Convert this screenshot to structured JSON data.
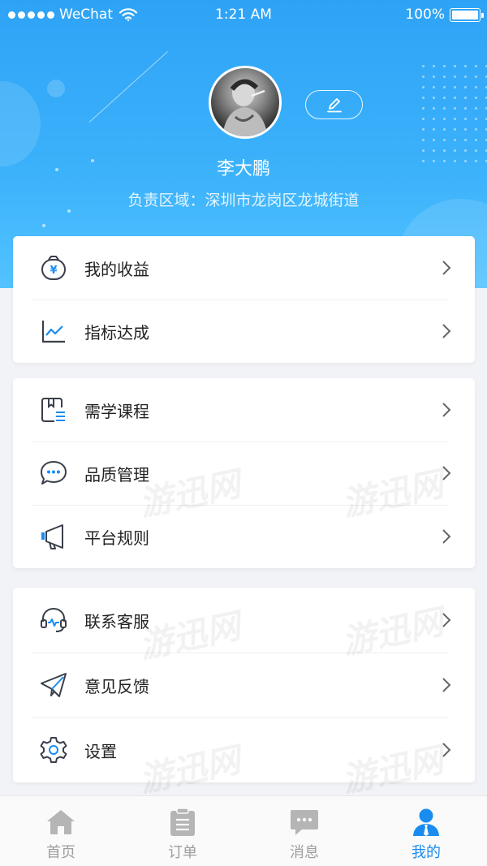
{
  "status_bar": {
    "carrier": "WeChat",
    "time": "1:21 AM",
    "battery": "100%"
  },
  "profile": {
    "name": "李大鹏",
    "area": "负责区域：深圳市龙岗区龙城街道"
  },
  "menu_groups": [
    {
      "items": [
        {
          "label": "我的收益",
          "icon": "wallet-yuan-icon"
        },
        {
          "label": "指标达成",
          "icon": "line-chart-icon"
        }
      ]
    },
    {
      "items": [
        {
          "label": "需学课程",
          "icon": "book-icon"
        },
        {
          "label": "品质管理",
          "icon": "chat-bubble-icon"
        },
        {
          "label": "平台规则",
          "icon": "megaphone-icon"
        }
      ]
    },
    {
      "items": [
        {
          "label": "联系客服",
          "icon": "headset-icon"
        },
        {
          "label": "意见反馈",
          "icon": "paper-plane-icon"
        },
        {
          "label": "设置",
          "icon": "gear-icon"
        }
      ]
    }
  ],
  "tabs": [
    {
      "label": "首页",
      "icon": "home-icon",
      "active": false
    },
    {
      "label": "订单",
      "icon": "clipboard-icon",
      "active": false
    },
    {
      "label": "消息",
      "icon": "message-icon",
      "active": false
    },
    {
      "label": "我的",
      "icon": "user-icon",
      "active": true
    }
  ],
  "colors": {
    "header_blue": "#2ea3f6",
    "accent": "#1a8cf0",
    "icon_dark": "#3a3f4a",
    "tab_inactive": "#b5b5b5"
  },
  "watermark": "游迅网"
}
